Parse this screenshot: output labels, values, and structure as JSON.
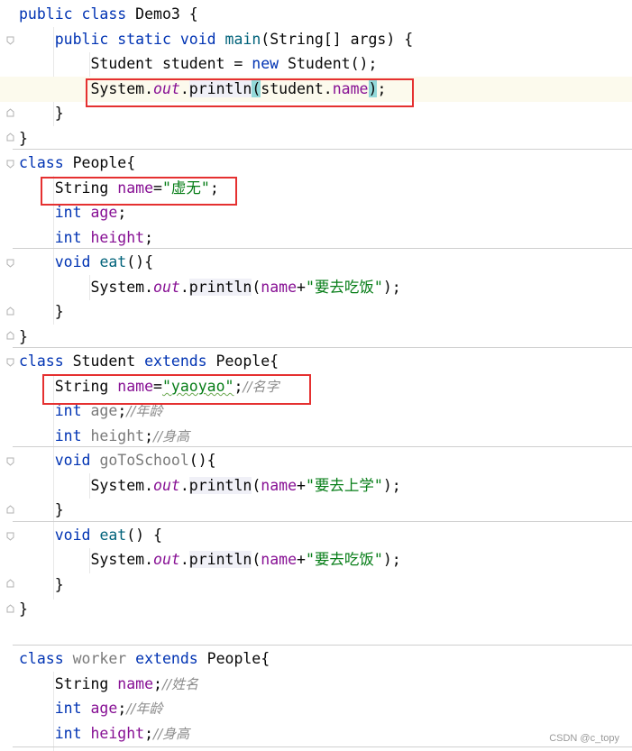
{
  "code": {
    "l1": {
      "kw1": "public",
      "sp1": " ",
      "kw2": "class",
      "rest": " Demo3 {"
    },
    "l2": {
      "kw1": "public",
      "kw2": "static",
      "kw3": "void",
      "m": "main",
      "args": "(String[] args) {"
    },
    "l3": {
      "a": "Student student = ",
      "kw": "new",
      "b": " Student();"
    },
    "l4": {
      "a": "System.",
      "out": "out",
      "b": ".",
      "m": "println",
      "p1": "(",
      "c": "student.",
      "f": "name",
      "p2": ")",
      ";": ";"
    },
    "l5": {
      "t": "}"
    },
    "l6": {
      "t": "}"
    },
    "l7": {
      "kw": "class",
      "rest": " People{"
    },
    "l8": {
      "a": "String ",
      "f": "name",
      "eq": "=",
      "s": "\"虚无\"",
      "e": ";"
    },
    "l9": {
      "kw": "int",
      "f": "age",
      "e": ";"
    },
    "l10": {
      "kw": "int",
      "f": "height",
      "e": ";"
    },
    "l11": {
      "kw": "void",
      "m": "eat",
      "e": "(){"
    },
    "l12": {
      "a": "System.",
      "out": "out",
      "b": ".",
      "m": "println",
      "p1": "(",
      "f": "name",
      "plus": "+",
      "s": "\"要去吃饭\"",
      "e": ");"
    },
    "l13": {
      "t": "}"
    },
    "l14": {
      "t": "}"
    },
    "l15": {
      "kw1": "class",
      "b": " Student ",
      "kw2": "extends",
      "c": " People{"
    },
    "l16": {
      "a": "String ",
      "f": "name",
      "eq": "=",
      "s": "\"yaoyao\"",
      "e": ";",
      "cm": "//名字"
    },
    "l17": {
      "kw": "int",
      "f": "age",
      "e": ";",
      "cm": "//年龄"
    },
    "l18": {
      "kw": "int",
      "f": "height",
      "e": ";",
      "cm": "//身高"
    },
    "l19": {
      "kw": "void",
      "m": "goToSchool",
      "e": "(){"
    },
    "l20": {
      "a": "System.",
      "out": "out",
      "b": ".",
      "m": "println",
      "p1": "(",
      "f": "name",
      "plus": "+",
      "s": "\"要去上学\"",
      "e": ");"
    },
    "l21": {
      "t": "}"
    },
    "l22": {
      "kw": "void",
      "m": "eat",
      "e": "() {"
    },
    "l23": {
      "a": "System.",
      "out": "out",
      "b": ".",
      "m": "println",
      "p1": "(",
      "f": "name",
      "plus": "+",
      "s": "\"要去吃饭\"",
      "e": ");"
    },
    "l24": {
      "t": "}"
    },
    "l25": {
      "t": "}"
    },
    "l27": {
      "kw1": "class",
      "b": " worker ",
      "kw2": "extends",
      "c": " People{"
    },
    "l28": {
      "a": "String ",
      "f": "name",
      "e": ";",
      "cm": "//姓名"
    },
    "l29": {
      "kw": "int",
      "f": "age",
      "e": ";",
      "cm": "//年龄"
    },
    "l30": {
      "kw": "int",
      "f": "height",
      "e": ";",
      "cm": "//身高"
    }
  },
  "watermark": "CSDN @c_topy"
}
